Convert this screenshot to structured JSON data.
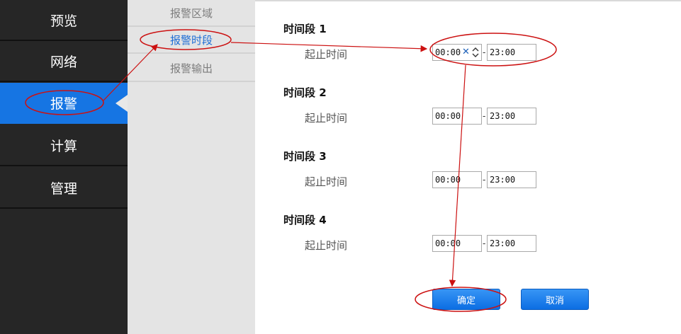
{
  "nav": {
    "items": [
      {
        "label": "预览"
      },
      {
        "label": "网络"
      },
      {
        "label": "报警"
      },
      {
        "label": "计算"
      },
      {
        "label": "管理"
      }
    ],
    "active_index": 2
  },
  "subnav": {
    "items": [
      {
        "label": "报警区域"
      },
      {
        "label": "报警时段"
      },
      {
        "label": "报警输出"
      }
    ],
    "active_index": 1
  },
  "periods": [
    {
      "title": "时间段 1",
      "range_label": "起止时间",
      "start": "00:00",
      "end": "23:00"
    },
    {
      "title": "时间段 2",
      "range_label": "起止时间",
      "start": "00:00",
      "end": "23:00"
    },
    {
      "title": "时间段 3",
      "range_label": "起止时间",
      "start": "00:00",
      "end": "23:00"
    },
    {
      "title": "时间段 4",
      "range_label": "起止时间",
      "start": "00:00",
      "end": "23:00"
    }
  ],
  "separator": "-",
  "buttons": {
    "confirm": "确定",
    "cancel": "取消"
  },
  "colors": {
    "nav_bg": "#262626",
    "nav_active": "#1675e3",
    "submenu_bg": "#e4e4e4",
    "submenu_active_text": "#1f6fd6",
    "annotation": "#cc1111"
  }
}
